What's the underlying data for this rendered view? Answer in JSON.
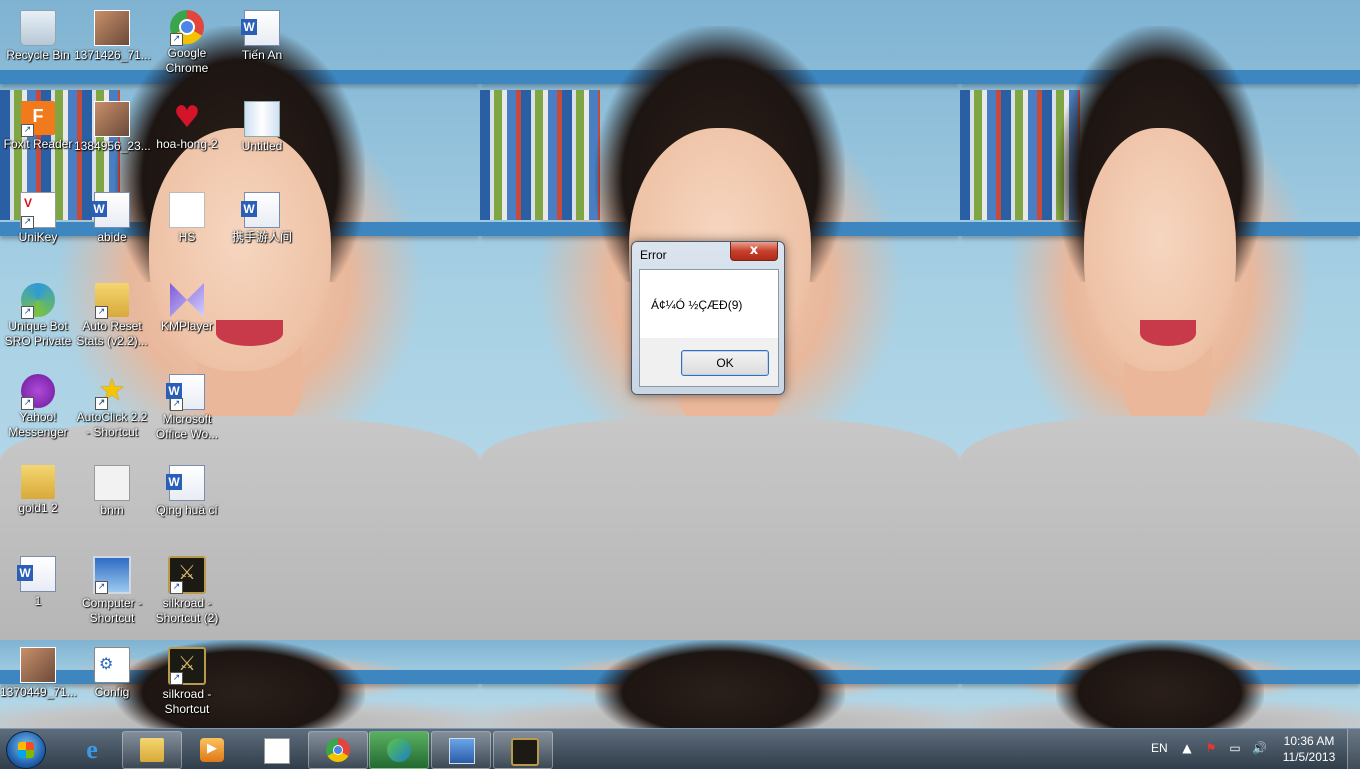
{
  "desktop": {
    "icons": [
      {
        "label": "Recycle Bin",
        "icon": "recycle-bin-icon"
      },
      {
        "label": "1371426_71...",
        "icon": "photo-icon"
      },
      {
        "label": "Google\nChrome",
        "icon": "chrome-icon"
      },
      {
        "label": "Tiến An",
        "icon": "word-document-icon"
      },
      {
        "label": "Foxit Reader",
        "icon": "foxit-reader-icon"
      },
      {
        "label": "1384956_23...",
        "icon": "photo-icon"
      },
      {
        "label": "hoa-hong-2",
        "icon": "rose-image-icon"
      },
      {
        "label": "Untitled",
        "icon": "image-icon"
      },
      {
        "label": "UniKey",
        "icon": "unikey-icon"
      },
      {
        "label": "abide",
        "icon": "word-document-icon"
      },
      {
        "label": "HS",
        "icon": "image-icon"
      },
      {
        "label": "携手游人间",
        "icon": "word-document-icon"
      },
      {
        "label": "Unique Bot\nSRO Private",
        "icon": "unique-bot-icon"
      },
      {
        "label": "Auto Reset\nStats (v2.2)...",
        "icon": "folder-shortcut-icon"
      },
      {
        "label": "KMPlayer",
        "icon": "kmplayer-icon"
      },
      {
        "label": "Yahoo!\nMessenger",
        "icon": "yahoo-messenger-icon"
      },
      {
        "label": "AutoClick 2.2\n- Shortcut",
        "icon": "autoclick-icon"
      },
      {
        "label": "Microsoft\nOffice Wo...",
        "icon": "word-application-icon"
      },
      {
        "label": "gold1 2",
        "icon": "folder-icon"
      },
      {
        "label": "bnm",
        "icon": "image-icon"
      },
      {
        "label": "Qing huā cí",
        "icon": "word-document-icon"
      },
      {
        "label": "1",
        "icon": "word-document-icon"
      },
      {
        "label": "Computer -\nShortcut",
        "icon": "computer-icon"
      },
      {
        "label": "silkroad -\nShortcut (2)",
        "icon": "silkroad-icon"
      },
      {
        "label": "1370449_71...",
        "icon": "photo-icon"
      },
      {
        "label": "Config",
        "icon": "config-icon"
      },
      {
        "label": "silkroad -\nShortcut",
        "icon": "silkroad-icon"
      }
    ]
  },
  "dialog": {
    "title": "Error",
    "close_symbol": "x",
    "message": "Á¢¼Ó ½ÇÆÐ(9)",
    "ok_label": "OK"
  },
  "taskbar": {
    "pinned": [
      {
        "name": "internet-explorer",
        "icon": "internet-explorer-icon"
      },
      {
        "name": "windows-explorer",
        "icon": "folder-icon"
      },
      {
        "name": "media-player",
        "icon": "media-player-icon"
      },
      {
        "name": "unikey",
        "icon": "unikey-icon"
      },
      {
        "name": "google-chrome",
        "icon": "chrome-icon"
      },
      {
        "name": "download-manager",
        "icon": "download-manager-icon"
      },
      {
        "name": "remote-desktop",
        "icon": "remote-desktop-icon"
      },
      {
        "name": "silkroad",
        "icon": "silkroad-icon"
      }
    ],
    "tray": {
      "language": "EN",
      "time": "10:36 AM",
      "date": "11/5/2013"
    }
  }
}
